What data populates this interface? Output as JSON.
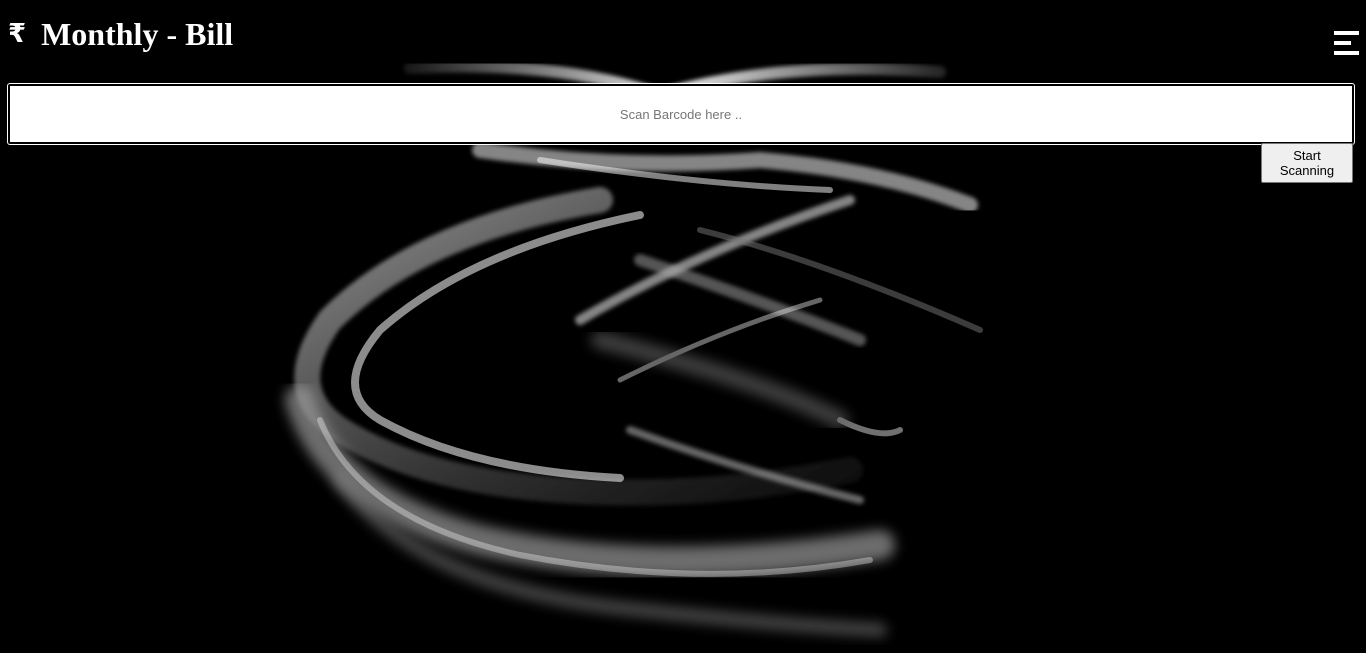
{
  "header": {
    "currency_symbol": "₹",
    "title": "Monthly - Bill"
  },
  "menu": {
    "icon": "hamburger-menu-icon"
  },
  "scanner": {
    "placeholder": "Scan Barcode here ..",
    "value": "",
    "start_button_label": "Start Scanning"
  },
  "colors": {
    "background": "#000000",
    "text": "#ffffff",
    "input_background": "#ffffff",
    "button_background": "#efefef"
  }
}
